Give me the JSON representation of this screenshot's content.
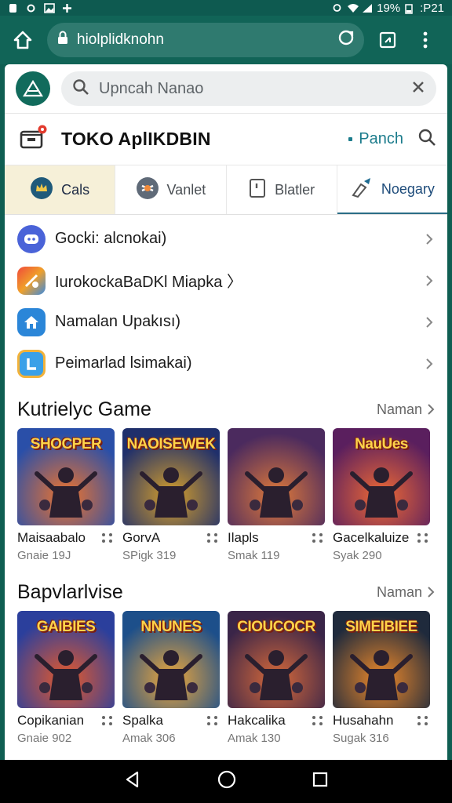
{
  "status_bar": {
    "battery": "19%",
    "time": ":P21"
  },
  "browser": {
    "url": "hiolplidknohn"
  },
  "search": {
    "placeholder": "Upncah Nanao"
  },
  "store": {
    "title": "TOKO AplIKDBIN",
    "link": "Panch"
  },
  "tabs": [
    {
      "label": "Cals"
    },
    {
      "label": "Vanlet"
    },
    {
      "label": "Blatler"
    },
    {
      "label": "Noegary"
    }
  ],
  "menu": [
    {
      "label": "Gocki: alcnokai)",
      "icon": "discord-icon",
      "color": "#4a63d8"
    },
    {
      "label": "IurokockaBaDKl Miapka 〉",
      "icon": "puzzle-icon",
      "color": "#f07a2a"
    },
    {
      "label": "Namalan Upakısı)",
      "icon": "home-icon",
      "color": "#2b86d8"
    },
    {
      "label": "Peimarlad lsimakai)",
      "icon": "l-app-icon",
      "color": "#3aa0e8"
    }
  ],
  "sections": [
    {
      "title": "Kutrielyc Game",
      "more": "Naman",
      "items": [
        {
          "name": "Maisaabalo",
          "sub": "Gnaie 19J",
          "art": "SHOCPER",
          "bg": [
            "#2a4fa8",
            "#f0742c"
          ]
        },
        {
          "name": "GorvA",
          "sub": "SPigk 319",
          "art": "NAOISEWEK",
          "bg": [
            "#1f2f6b",
            "#d8a02a"
          ]
        },
        {
          "name": "Ilapls",
          "sub": "Smak 119",
          "art": "",
          "bg": [
            "#4b2a5e",
            "#e07a3a"
          ]
        },
        {
          "name": "Gacelkaluize",
          "sub": "Syak 290",
          "art": "NauUes",
          "bg": [
            "#5a1f5e",
            "#f06a34"
          ]
        }
      ]
    },
    {
      "title": "Bapvlarlvise",
      "more": "Naman",
      "items": [
        {
          "name": "Copikanian",
          "sub": "Gnaie 902",
          "art": "GAIBIES",
          "bg": [
            "#2b3f9c",
            "#e85a2a"
          ]
        },
        {
          "name": "Spalka",
          "sub": "Amak 306",
          "art": "NNUNES",
          "bg": [
            "#1d4f8a",
            "#f0a83a"
          ]
        },
        {
          "name": "Hakcalika",
          "sub": "Amak 130",
          "art": "CIOUCOCR",
          "bg": [
            "#3a2548",
            "#d86a3a"
          ]
        },
        {
          "name": "Husahahn",
          "sub": "Sugak 316",
          "art": "SIMEIBIEE",
          "bg": [
            "#1f2a3c",
            "#f08a2a"
          ]
        }
      ]
    }
  ]
}
